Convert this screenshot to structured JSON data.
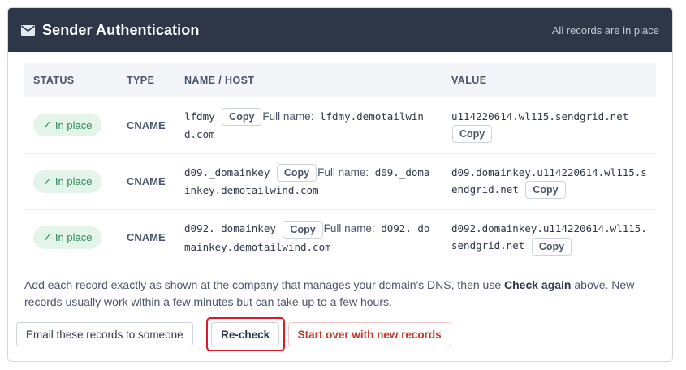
{
  "header": {
    "title": "Sender Authentication",
    "status": "All records are in place"
  },
  "table": {
    "columns": [
      "STATUS",
      "TYPE",
      "NAME / HOST",
      "VALUE"
    ],
    "full_name_label": "Full name:",
    "copy_label": "Copy",
    "rows": [
      {
        "status": "In place",
        "type": "CNAME",
        "host": "lfdmy",
        "full_name": "lfdmy.demotailwind.com",
        "value": "u114220614.wl115.sendgrid.net"
      },
      {
        "status": "In place",
        "type": "CNAME",
        "host": "d09._domainkey",
        "full_name": "d09._domainkey.demotailwind.com",
        "value": "d09.domainkey.u114220614.wl115.sendgrid.net"
      },
      {
        "status": "In place",
        "type": "CNAME",
        "host": "d092._domainkey",
        "full_name": "d092._domainkey.demotailwind.com",
        "value": "d092.domainkey.u114220614.wl115.sendgrid.net"
      }
    ]
  },
  "help": {
    "before": "Add each record exactly as shown at the company that manages your domain's DNS, then use ",
    "emphasis": "Check again",
    "after": " above. New records usually work within a few minutes but can take up to a few hours."
  },
  "actions": {
    "email_label": "Email these records to someone",
    "recheck_label": "Re-check",
    "startover_label": "Start over with new records"
  },
  "icons": {
    "header": "envelope-icon",
    "status": "check-icon"
  },
  "colors": {
    "header_bg": "#2d3748",
    "badge_bg": "#e3f4ea",
    "badge_text": "#2e8b57",
    "highlight": "#e0162b",
    "danger_text": "#c0392b"
  }
}
